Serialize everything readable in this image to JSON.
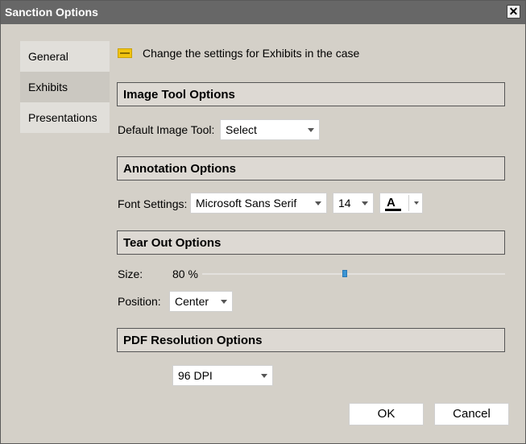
{
  "window": {
    "title": "Sanction Options",
    "close_label": "✕"
  },
  "nav": {
    "items": [
      {
        "label": "General"
      },
      {
        "label": "Exhibits"
      },
      {
        "label": "Presentations"
      }
    ]
  },
  "header": {
    "text": "Change the settings for Exhibits in the case",
    "icon": "exhibit-icon"
  },
  "image_tool": {
    "section_title": "Image Tool Options",
    "label": "Default Image Tool:",
    "value": "Select"
  },
  "annotation": {
    "section_title": "Annotation Options",
    "label": "Font Settings:",
    "font": "Microsoft Sans Serif",
    "size": "14",
    "color_letter": "A",
    "color": "#000000"
  },
  "tear_out": {
    "section_title": "Tear Out Options",
    "size_label": "Size:",
    "size_value": "80 %",
    "size_percent": 80,
    "position_label": "Position:",
    "position_value": "Center"
  },
  "pdf": {
    "section_title": "PDF Resolution Options",
    "value": "96 DPI"
  },
  "buttons": {
    "ok": "OK",
    "cancel": "Cancel"
  },
  "colors": {
    "accent": "#3b95d4",
    "titlebar": "#676767",
    "dialog": "#d4d0c8"
  }
}
